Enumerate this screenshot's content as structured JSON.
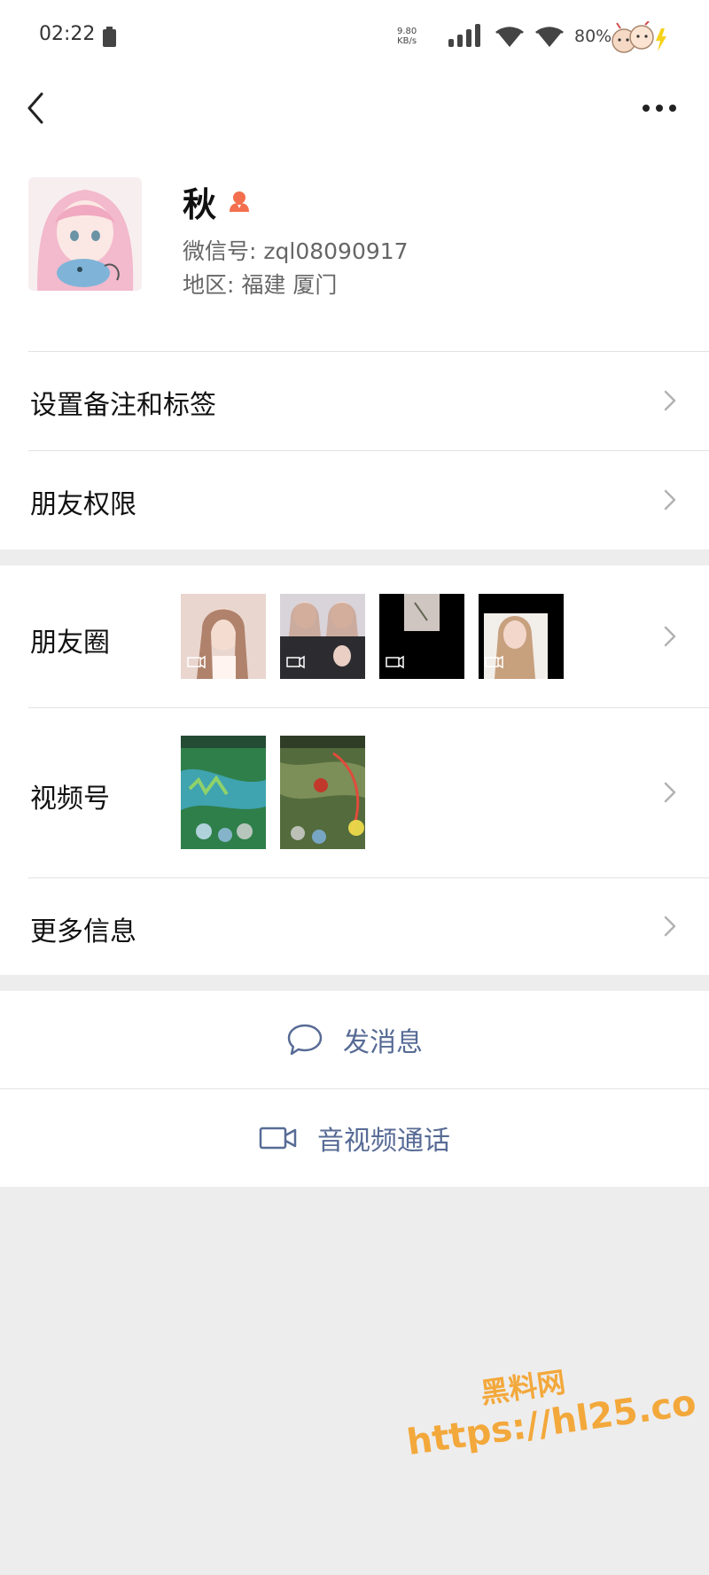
{
  "status_bar": {
    "time": "02:22",
    "net_speed_value": "9.80",
    "net_speed_unit": "KB/s",
    "battery_percent": "80%"
  },
  "nav": {
    "back_icon": "chevron-left-icon",
    "more_icon": "more-dots-icon"
  },
  "profile": {
    "name": "秋",
    "gender_icon": "female-icon",
    "wechat_id_label": "微信号:",
    "wechat_id": "zql08090917",
    "region_label": "地区:",
    "region": "福建 厦门"
  },
  "rows": {
    "remark_tags": "设置备注和标签",
    "friend_permissions": "朋友权限",
    "moments": "朋友圈",
    "channels": "视频号",
    "more_info": "更多信息"
  },
  "actions": {
    "send_message": "发消息",
    "video_call": "音视频通话"
  },
  "watermark": {
    "line1": "黑料网",
    "line2": "https://hl25.co"
  },
  "colors": {
    "link_blue": "#576b95",
    "gender_orange": "#f36f4e",
    "watermark_orange": "#f3a83b"
  }
}
